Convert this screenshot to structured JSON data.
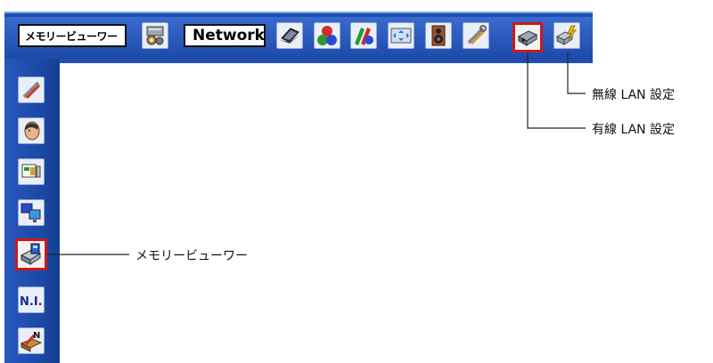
{
  "toolbar": {
    "memory_viewer_label": "メモリービューワー",
    "network_label": "Network",
    "icons": [
      {
        "name": "memory-card-icon"
      },
      {
        "name": "laptop-icon"
      },
      {
        "name": "color-balls-icon"
      },
      {
        "name": "color-adjust-icon"
      },
      {
        "name": "screen-adjust-icon"
      },
      {
        "name": "speaker-icon"
      },
      {
        "name": "settings-tools-icon"
      },
      {
        "name": "wired-lan-icon",
        "selected": true
      },
      {
        "name": "wireless-lan-icon"
      }
    ]
  },
  "sidebar": {
    "icons": [
      {
        "name": "tools-icon"
      },
      {
        "name": "person-head-icon"
      },
      {
        "name": "slideshow-icon"
      },
      {
        "name": "monitors-icon"
      },
      {
        "name": "memory-viewer-icon",
        "selected": true
      },
      {
        "name": "ni-icon",
        "text": "N.I."
      },
      {
        "name": "network-folder-icon",
        "text": "N"
      }
    ]
  },
  "callouts": {
    "wireless_lan": "無線 LAN 設定",
    "wired_lan": "有線 LAN 設定",
    "memory_viewer": "メモリービューワー"
  },
  "colors": {
    "bar_blue": "#1f4fb0",
    "selected_border": "#d01818"
  }
}
